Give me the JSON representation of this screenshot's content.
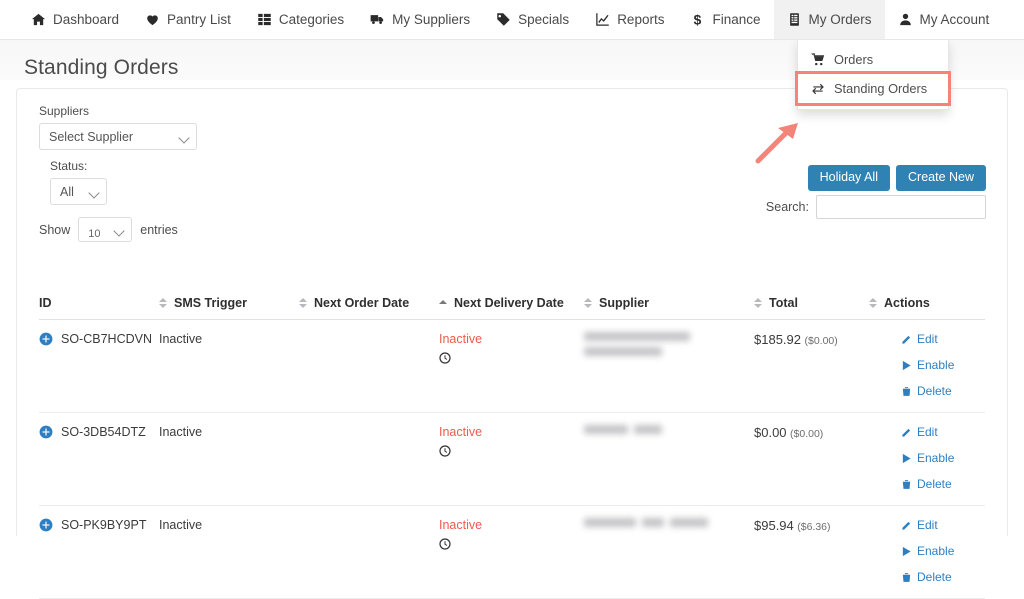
{
  "nav": {
    "items": [
      {
        "label": "Dashboard",
        "icon": "home-icon",
        "active": false
      },
      {
        "label": "Pantry List",
        "icon": "heart-icon",
        "active": false
      },
      {
        "label": "Categories",
        "icon": "grid-icon",
        "active": false
      },
      {
        "label": "My Suppliers",
        "icon": "truck-icon",
        "active": false
      },
      {
        "label": "Specials",
        "icon": "tag-icon",
        "active": false
      },
      {
        "label": "Reports",
        "icon": "chart-line-icon",
        "active": false
      },
      {
        "label": "Finance",
        "icon": "dollar-icon",
        "active": false
      },
      {
        "label": "My Orders",
        "icon": "receipt-icon",
        "active": true
      },
      {
        "label": "My Account",
        "icon": "user-icon",
        "active": false
      }
    ]
  },
  "dropdown": {
    "items": [
      {
        "label": "Orders",
        "icon": "cart-icon",
        "highlighted": false
      },
      {
        "label": "Standing Orders",
        "icon": "exchange-icon",
        "highlighted": true
      }
    ],
    "highlight_color": "#f4847a"
  },
  "page": {
    "title": "Standing Orders"
  },
  "filters": {
    "suppliers_label": "Suppliers",
    "supplier_value": "Select Supplier",
    "status_label": "Status:",
    "status_value": "All",
    "show_label": "Show",
    "length_value": "10",
    "entries_label": "entries"
  },
  "toolbar": {
    "holiday_all_label": "Holiday All",
    "create_new_label": "Create New",
    "button_color": "#2e82b4",
    "search_label": "Search:",
    "search_value": "",
    "search_placeholder": ""
  },
  "table": {
    "columns": [
      {
        "key": "id",
        "label": "ID",
        "sort": "none"
      },
      {
        "key": "sms",
        "label": "SMS Trigger",
        "sort": "none"
      },
      {
        "key": "nod",
        "label": "Next Order Date",
        "sort": "asc"
      },
      {
        "key": "ndd",
        "label": "Next Delivery Date",
        "sort": "none"
      },
      {
        "key": "sup",
        "label": "Supplier",
        "sort": "none"
      },
      {
        "key": "tot",
        "label": "Total",
        "sort": "none"
      },
      {
        "key": "act",
        "label": "Actions",
        "sort": null
      }
    ],
    "rows": [
      {
        "id": "SO-CB7HCDVN",
        "sms_trigger": "Inactive",
        "next_order_date": "",
        "next_delivery_date": "Inactive",
        "supplier": "",
        "supplier_redacted": true,
        "total": "$185.92",
        "total_sub": "($0.00)",
        "actions": [
          "Edit",
          "Enable",
          "Delete"
        ]
      },
      {
        "id": "SO-3DB54DTZ",
        "sms_trigger": "Inactive",
        "next_order_date": "",
        "next_delivery_date": "Inactive",
        "supplier": "",
        "supplier_redacted": true,
        "total": "$0.00",
        "total_sub": "($0.00)",
        "actions": [
          "Edit",
          "Enable",
          "Delete"
        ]
      },
      {
        "id": "SO-PK9BY9PT",
        "sms_trigger": "Inactive",
        "next_order_date": "",
        "next_delivery_date": "Inactive",
        "supplier": "",
        "supplier_redacted": true,
        "total": "$95.94",
        "total_sub": "($6.36)",
        "actions": [
          "Edit",
          "Enable",
          "Delete"
        ]
      }
    ],
    "inactive_color": "#f15a4e",
    "action_link_color": "#2e7fc2"
  }
}
